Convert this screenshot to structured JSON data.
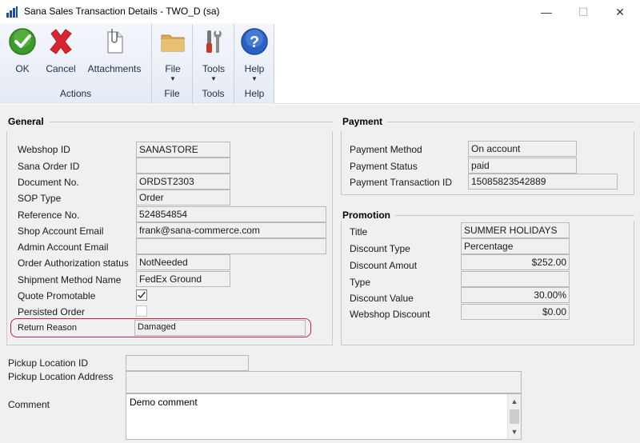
{
  "window": {
    "title": "Sana Sales Transaction Details  -  TWO_D (sa)",
    "minimize": "—",
    "maximize": "☐",
    "close": "✕"
  },
  "ribbon": {
    "groups": [
      {
        "label": "Actions",
        "buttons": [
          {
            "label": "OK",
            "icon": "ok-check-icon"
          },
          {
            "label": "Cancel",
            "icon": "cancel-x-icon"
          },
          {
            "label": "Attachments",
            "icon": "paperclip-document-icon"
          }
        ]
      },
      {
        "label": "File",
        "buttons": [
          {
            "label": "File",
            "icon": "folder-icon"
          }
        ]
      },
      {
        "label": "Tools",
        "buttons": [
          {
            "label": "Tools",
            "icon": "tools-icon"
          }
        ]
      },
      {
        "label": "Help",
        "buttons": [
          {
            "label": "Help",
            "icon": "help-question-icon"
          }
        ]
      }
    ],
    "dropdown_arrow": "▼"
  },
  "general": {
    "title": "General",
    "webshop_id": {
      "label": "Webshop ID",
      "value": "SANASTORE"
    },
    "sana_order_id": {
      "label": "Sana Order ID",
      "value": ""
    },
    "document_no": {
      "label": "Document No.",
      "value": "ORDST2303"
    },
    "sop_type": {
      "label": "SOP Type",
      "value": "Order"
    },
    "reference_no": {
      "label": "Reference No.",
      "value": "524854854"
    },
    "shop_account_email": {
      "label": "Shop Account Email",
      "value": "frank@sana-commerce.com"
    },
    "admin_account_email": {
      "label": "Admin Account Email",
      "value": ""
    },
    "order_authorization_status": {
      "label": "Order Authorization status",
      "value": "NotNeeded"
    },
    "shipment_method_name": {
      "label": "Shipment Method Name",
      "value": "FedEx Ground"
    },
    "quote_promotable": {
      "label": "Quote Promotable",
      "checked": true
    },
    "persisted_order": {
      "label": "Persisted Order",
      "checked": false
    },
    "return_reason": {
      "label": "Return Reason",
      "value": "Damaged"
    }
  },
  "payment": {
    "title": "Payment",
    "method": {
      "label": "Payment Method",
      "value": "On account"
    },
    "status": {
      "label": "Payment Status",
      "value": "paid"
    },
    "transaction_id": {
      "label": "Payment Transaction ID",
      "value": "15085823542889"
    }
  },
  "promotion": {
    "title": "Promotion",
    "title_field": {
      "label": "Title",
      "value": "SUMMER HOLIDAYS"
    },
    "discount_type": {
      "label": "Discount Type",
      "value": "Percentage"
    },
    "discount_amount": {
      "label": "Discount Amout",
      "value": "$252.00"
    },
    "type": {
      "label": "Type",
      "value": ""
    },
    "discount_value": {
      "label": "Discount Value",
      "value": "30.00%"
    },
    "webshop_discount": {
      "label": "Webshop Discount",
      "value": "$0.00"
    }
  },
  "pickup": {
    "location_id": {
      "label": "Pickup Location ID",
      "value": ""
    },
    "location_address": {
      "label": "Pickup Location Address",
      "value": ""
    }
  },
  "comment": {
    "label": "Comment",
    "value": "Demo comment",
    "scroll_up": "▲",
    "scroll_down": "▼"
  },
  "colors": {
    "highlight": "#c9203a",
    "ribbon_text": "#1f2d45"
  }
}
